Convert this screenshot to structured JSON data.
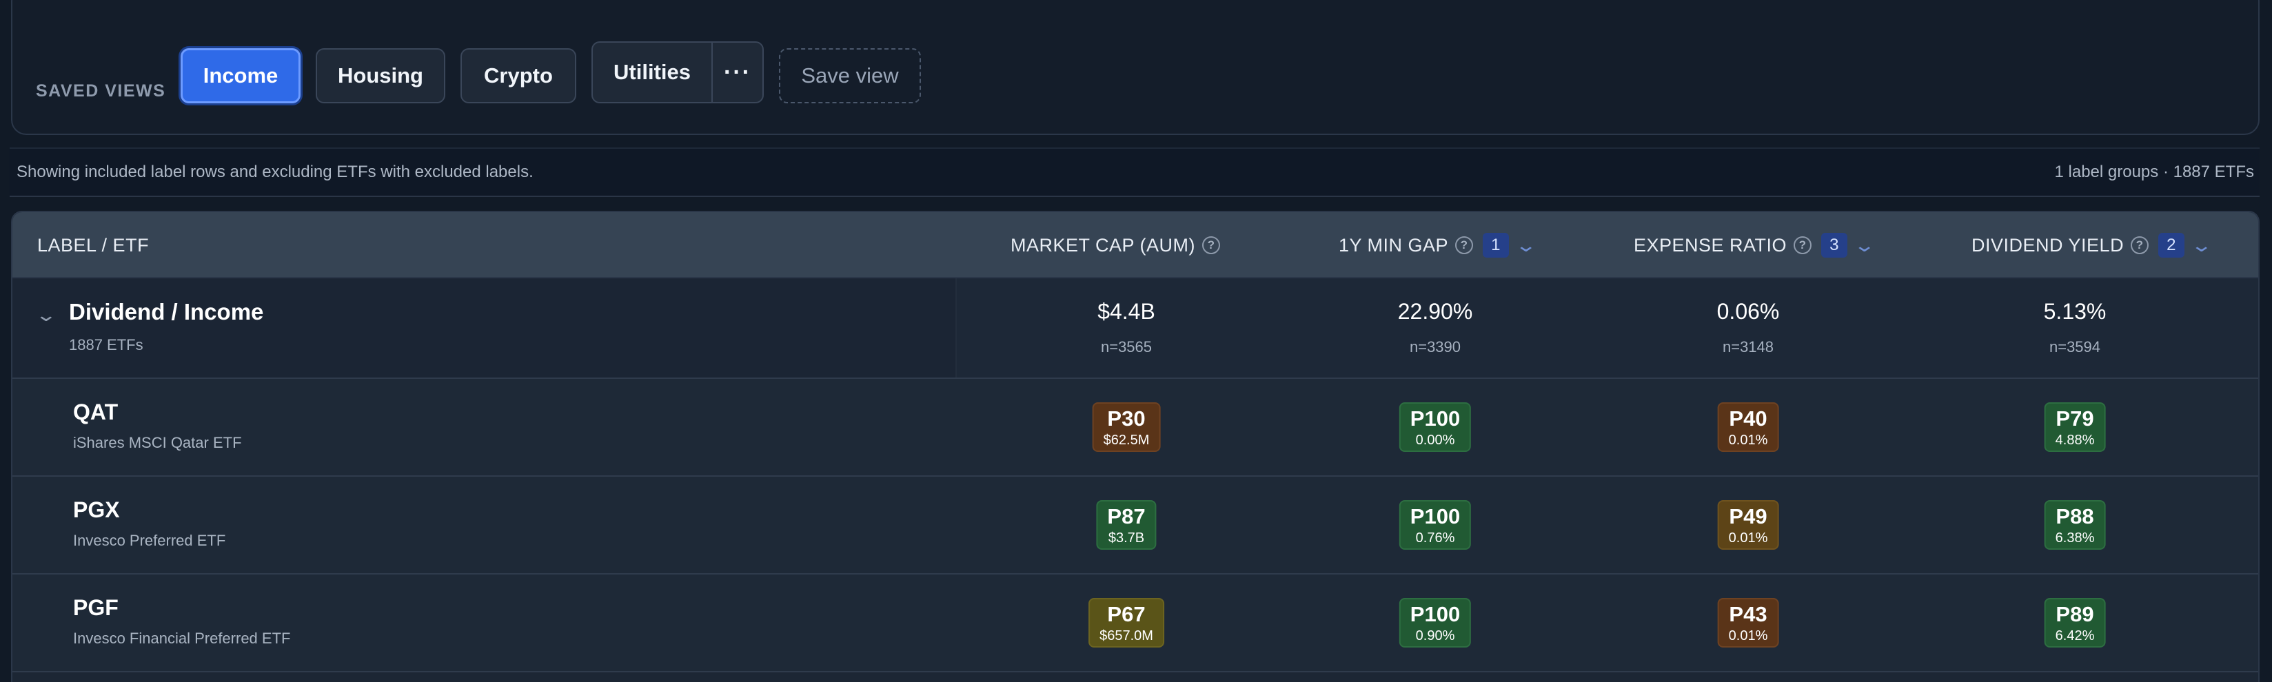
{
  "saved_views": {
    "label": "SAVED VIEWS",
    "chips": [
      "Income",
      "Housing",
      "Crypto",
      "Utilities"
    ],
    "more_label": "···",
    "save_label": "Save view"
  },
  "info": {
    "left": "Showing included label rows and excluding ETFs with excluded labels.",
    "right": "1 label groups · 1887 ETFs"
  },
  "columns": {
    "label": "LABEL / ETF",
    "market_cap": "MARKET CAP (AUM)",
    "min_gap": "1Y MIN GAP",
    "min_gap_badge": "1",
    "expense": "EXPENSE RATIO",
    "expense_badge": "3",
    "dividend": "DIVIDEND YIELD",
    "dividend_badge": "2",
    "help_icon": "?"
  },
  "group": {
    "title": "Dividend / Income",
    "sub": "1887 ETFs",
    "market_cap": {
      "v": "$4.4B",
      "n": "n=3565"
    },
    "min_gap": {
      "v": "22.90%",
      "n": "n=3390"
    },
    "expense": {
      "v": "0.06%",
      "n": "n=3148"
    },
    "dividend": {
      "v": "5.13%",
      "n": "n=3594"
    }
  },
  "rows": [
    {
      "ticker": "QAT",
      "name": "iShares MSCI Qatar ETF",
      "market_cap": {
        "p": "P30",
        "s": "$62.5M",
        "color": "#5a3418"
      },
      "min_gap": {
        "p": "P100",
        "s": "0.00%",
        "color": "#215a33"
      },
      "expense": {
        "p": "P40",
        "s": "0.01%",
        "color": "#5a3418"
      },
      "dividend": {
        "p": "P79",
        "s": "4.88%",
        "color": "#215a33"
      }
    },
    {
      "ticker": "PGX",
      "name": "Invesco Preferred ETF",
      "market_cap": {
        "p": "P87",
        "s": "$3.7B",
        "color": "#215a33"
      },
      "min_gap": {
        "p": "P100",
        "s": "0.76%",
        "color": "#215a33"
      },
      "expense": {
        "p": "P49",
        "s": "0.01%",
        "color": "#5d4417"
      },
      "dividend": {
        "p": "P88",
        "s": "6.38%",
        "color": "#215a33"
      }
    },
    {
      "ticker": "PGF",
      "name": "Invesco Financial Preferred ETF",
      "market_cap": {
        "p": "P67",
        "s": "$657.0M",
        "color": "#5a5418"
      },
      "min_gap": {
        "p": "P100",
        "s": "0.90%",
        "color": "#215a33"
      },
      "expense": {
        "p": "P43",
        "s": "0.01%",
        "color": "#5a3418"
      },
      "dividend": {
        "p": "P89",
        "s": "6.42%",
        "color": "#215a33"
      }
    }
  ]
}
